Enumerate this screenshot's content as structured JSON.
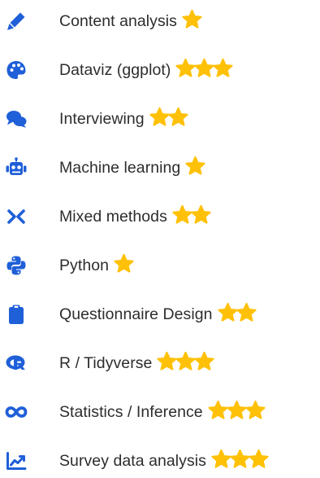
{
  "colors": {
    "icon": "#1f5fd8",
    "star": "#ffc107",
    "text": "#2d2d2d"
  },
  "skills": [
    {
      "label": "Content analysis",
      "icon": "pen-icon",
      "stars": 1
    },
    {
      "label": "Dataviz (ggplot)",
      "icon": "palette-icon",
      "stars": 3
    },
    {
      "label": "Interviewing",
      "icon": "comments-icon",
      "stars": 2
    },
    {
      "label": "Machine learning",
      "icon": "robot-icon",
      "stars": 1
    },
    {
      "label": "Mixed methods",
      "icon": "arrows-merge-icon",
      "stars": 2
    },
    {
      "label": "Python",
      "icon": "python-icon",
      "stars": 1
    },
    {
      "label": "Questionnaire Design",
      "icon": "clipboard-icon",
      "stars": 2
    },
    {
      "label": "R / Tidyverse",
      "icon": "r-logo-icon",
      "stars": 3
    },
    {
      "label": "Statistics / Inference",
      "icon": "infinity-icon",
      "stars": 3
    },
    {
      "label": "Survey data analysis",
      "icon": "line-chart-icon",
      "stars": 3
    }
  ]
}
